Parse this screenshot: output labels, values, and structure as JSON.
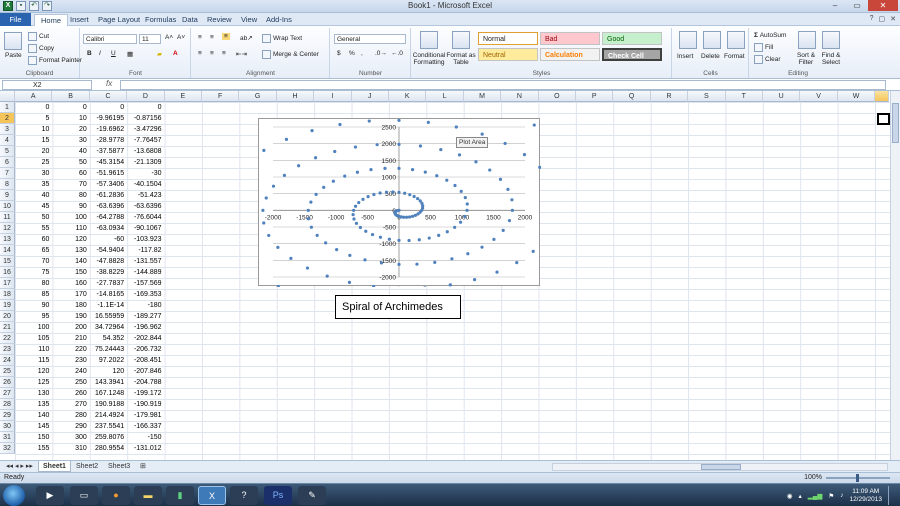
{
  "window": {
    "title": "Book1 - Microsoft Excel",
    "controls": [
      "–",
      "▭",
      "✕"
    ]
  },
  "ribbon_tabs": [
    "File",
    "Home",
    "Insert",
    "Page Layout",
    "Formulas",
    "Data",
    "Review",
    "View",
    "Add-Ins"
  ],
  "ribbon": {
    "clipboard": {
      "paste": "Paste",
      "cut": "Cut",
      "copy": "Copy",
      "format_painter": "Format Painter",
      "label": "Clipboard"
    },
    "font": {
      "name": "Calibri",
      "size": "11",
      "bold": "B",
      "italic": "I",
      "underline": "U",
      "label": "Font"
    },
    "alignment": {
      "wrap": "Wrap Text",
      "merge": "Merge & Center",
      "label": "Alignment"
    },
    "number": {
      "format": "General",
      "currency": "$",
      "percent": "%",
      "comma": ",",
      "label": "Number"
    },
    "styles": {
      "conditional": "Conditional Formatting",
      "format_table": "Format as Table",
      "cells": [
        "Normal",
        "Bad",
        "Good",
        "Neutral",
        "Calculation",
        "Check Cell"
      ],
      "label": "Styles"
    },
    "cells_group": {
      "insert": "Insert",
      "delete": "Delete",
      "format": "Format",
      "label": "Cells"
    },
    "editing": {
      "autosum": "AutoSum",
      "fill": "Fill",
      "clear": "Clear",
      "sort": "Sort & Filter",
      "find": "Find & Select",
      "label": "Editing"
    }
  },
  "formula_bar": {
    "name_box": "X2",
    "fx": "fx",
    "formula": ""
  },
  "columns": [
    "A",
    "B",
    "C",
    "D",
    "E",
    "F",
    "G",
    "H",
    "I",
    "J",
    "K",
    "L",
    "M",
    "N",
    "O",
    "P",
    "Q",
    "R",
    "S",
    "T",
    "U",
    "V",
    "W"
  ],
  "row_numbers": [
    "1",
    "2",
    "3",
    "4",
    "5",
    "6",
    "7",
    "8",
    "9",
    "10",
    "11",
    "12",
    "13",
    "14",
    "15",
    "16",
    "17",
    "18",
    "19",
    "20",
    "21",
    "22",
    "23",
    "24",
    "25",
    "26",
    "27",
    "28",
    "29",
    "30",
    "31",
    "32"
  ],
  "rows": [
    [
      "0",
      "0",
      "0",
      "0"
    ],
    [
      "5",
      "10",
      "-9.96195",
      "-0.87156"
    ],
    [
      "10",
      "20",
      "-19.6962",
      "-3.47296"
    ],
    [
      "15",
      "30",
      "-28.9778",
      "-7.76457"
    ],
    [
      "20",
      "40",
      "-37.5877",
      "-13.6808"
    ],
    [
      "25",
      "50",
      "-45.3154",
      "-21.1309"
    ],
    [
      "30",
      "60",
      "-51.9615",
      "-30"
    ],
    [
      "35",
      "70",
      "-57.3406",
      "-40.1504"
    ],
    [
      "40",
      "80",
      "-61.2836",
      "-51.423"
    ],
    [
      "45",
      "90",
      "-63.6396",
      "-63.6396"
    ],
    [
      "50",
      "100",
      "-64.2788",
      "-76.6044"
    ],
    [
      "55",
      "110",
      "-63.0934",
      "-90.1067"
    ],
    [
      "60",
      "120",
      "-60",
      "-103.923"
    ],
    [
      "65",
      "130",
      "-54.9404",
      "-117.82"
    ],
    [
      "70",
      "140",
      "-47.8828",
      "-131.557"
    ],
    [
      "75",
      "150",
      "-38.8229",
      "-144.889"
    ],
    [
      "80",
      "160",
      "-27.7837",
      "-157.569"
    ],
    [
      "85",
      "170",
      "-14.8165",
      "-169.353"
    ],
    [
      "90",
      "180",
      "-1.1E-14",
      "-180"
    ],
    [
      "95",
      "190",
      "16.55959",
      "-189.277"
    ],
    [
      "100",
      "200",
      "34.72964",
      "-196.962"
    ],
    [
      "105",
      "210",
      "54.352",
      "-202.844"
    ],
    [
      "110",
      "220",
      "75.24443",
      "-206.732"
    ],
    [
      "115",
      "230",
      "97.2022",
      "-208.451"
    ],
    [
      "120",
      "240",
      "120",
      "-207.846"
    ],
    [
      "125",
      "250",
      "143.3941",
      "-204.788"
    ],
    [
      "130",
      "260",
      "167.1248",
      "-199.172"
    ],
    [
      "135",
      "270",
      "190.9188",
      "-190.919"
    ],
    [
      "140",
      "280",
      "214.4924",
      "-179.981"
    ],
    [
      "145",
      "290",
      "237.5541",
      "-166.337"
    ],
    [
      "150",
      "300",
      "259.8076",
      "-150"
    ],
    [
      "155",
      "310",
      "280.9554",
      "-131.012"
    ]
  ],
  "chart_data": {
    "type": "scatter",
    "x_ticks": [
      "-2000",
      "-1500",
      "-1000",
      "-500",
      "0",
      "500",
      "1000",
      "1500",
      "2000"
    ],
    "y_ticks": [
      "2500",
      "2000",
      "1500",
      "1000",
      "500",
      "0",
      "-500",
      "-1000",
      "-1500",
      "-2000"
    ],
    "xlim": [
      -2000,
      2000
    ],
    "ylim": [
      -2000,
      2500
    ],
    "spiral": {
      "a": -2,
      "theta_start_deg": 0,
      "theta_end_deg": 3330,
      "step_deg": 10
    },
    "marker_color": "#4f81bd",
    "grid": true,
    "tooltip": "Plot Area"
  },
  "caption": "Spiral of Archimedes",
  "sheet_tabs": [
    "Sheet1",
    "Sheet2",
    "Sheet3"
  ],
  "status": {
    "ready": "Ready",
    "zoom": "100%"
  },
  "taskbar": {
    "time": "11:09 AM",
    "date": "12/29/2013"
  }
}
